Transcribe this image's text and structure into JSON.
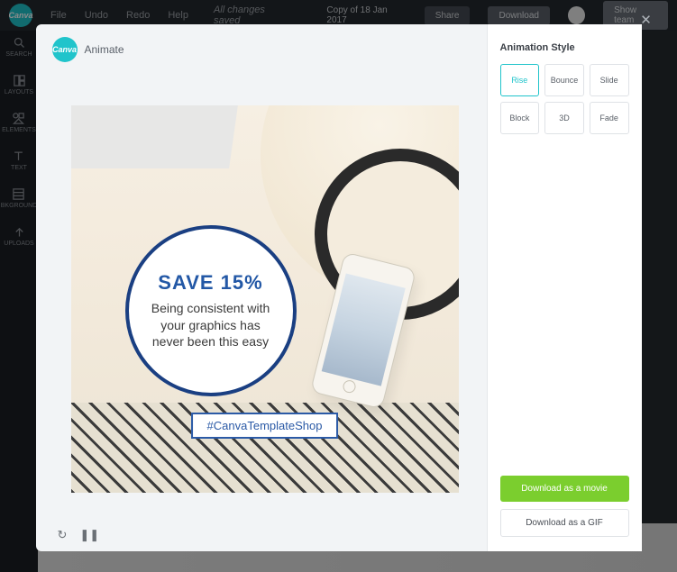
{
  "topbar": {
    "brand": "Canva",
    "menu": {
      "file": "File",
      "undo": "Undo",
      "redo": "Redo",
      "help": "Help"
    },
    "status": "All changes saved",
    "doc_title": "Copy of 18 Jan 2017",
    "share": "Share",
    "download": "Download",
    "show_team": "Show team"
  },
  "sidebar": {
    "items": [
      {
        "label": "SEARCH"
      },
      {
        "label": "LAYOUTS"
      },
      {
        "label": "ELEMENTS"
      },
      {
        "label": "TEXT"
      },
      {
        "label": "BKGROUND"
      },
      {
        "label": "UPLOADS"
      }
    ]
  },
  "modal": {
    "brand": "Canva",
    "title": "Animate",
    "canvas": {
      "headline": "SAVE 15%",
      "sub": "Being consistent with your graphics has never been this easy",
      "hashtag": "#CanvaTemplateShop"
    },
    "controls": {
      "replay": "↻",
      "pause": "❚❚"
    },
    "section_title": "Animation Style",
    "styles": [
      {
        "label": "Rise",
        "selected": true
      },
      {
        "label": "Bounce",
        "selected": false
      },
      {
        "label": "Slide",
        "selected": false
      },
      {
        "label": "Block",
        "selected": false
      },
      {
        "label": "3D",
        "selected": false
      },
      {
        "label": "Fade",
        "selected": false
      }
    ],
    "download_movie": "Download as a movie",
    "download_gif": "Download as a GIF"
  }
}
